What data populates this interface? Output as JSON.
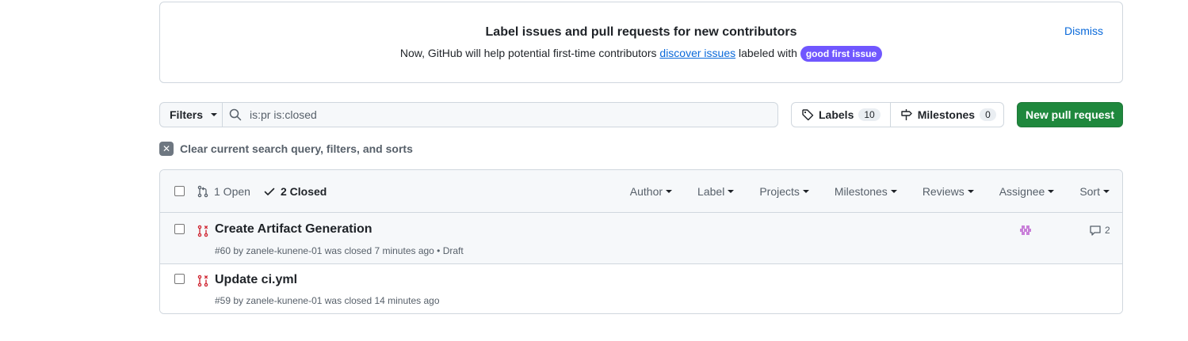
{
  "banner": {
    "title": "Label issues and pull requests for new contributors",
    "text_before": "Now, GitHub will help potential first-time contributors",
    "link": "discover issues",
    "text_after": "labeled with",
    "label": "good first issue",
    "label_color": "#7057ff",
    "dismiss": "Dismiss"
  },
  "filter_bar": {
    "filters_label": "Filters",
    "search_value": "is:pr is:closed",
    "labels_label": "Labels",
    "labels_count": "10",
    "milestones_label": "Milestones",
    "milestones_count": "0",
    "new_pr_label": "New pull request",
    "new_pr_color": "#1f883d"
  },
  "clear": {
    "label": "Clear current search query, filters, and sorts"
  },
  "list_header": {
    "open_label": "1 Open",
    "closed_label": "2 Closed",
    "filters": [
      "Author",
      "Label",
      "Projects",
      "Milestones",
      "Reviews",
      "Assignee",
      "Sort"
    ]
  },
  "pull_requests": [
    {
      "title": "Create Artifact Generation",
      "meta": "#60 by zanele-kunene-01 was closed 7 minutes ago • Draft",
      "comments": "2",
      "icon": "git-pull-request-closed-icon"
    },
    {
      "title": "Update ci.yml",
      "meta": "#59 by zanele-kunene-01 was closed 14 minutes ago",
      "icon": "git-pull-request-closed-icon"
    }
  ]
}
